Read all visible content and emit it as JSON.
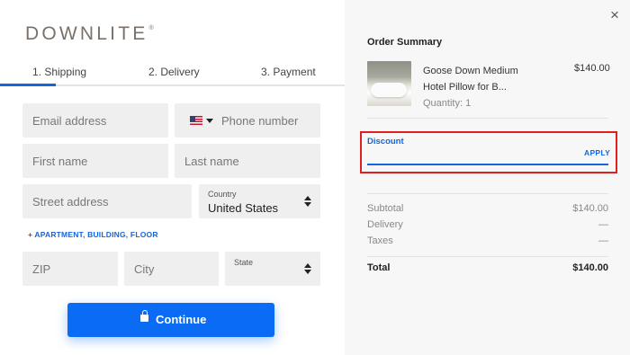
{
  "brand": {
    "logo_text": "DOWNLITE",
    "logo_mark": "®"
  },
  "steps": [
    {
      "label": "1. Shipping",
      "active": true
    },
    {
      "label": "2. Delivery",
      "active": false
    },
    {
      "label": "3. Payment",
      "active": false
    }
  ],
  "form": {
    "email_placeholder": "Email address",
    "phone_country_flag": "us-flag-icon",
    "phone_placeholder": "Phone number",
    "first_name_placeholder": "First name",
    "last_name_placeholder": "Last name",
    "street_placeholder": "Street address",
    "country_label": "Country",
    "country_value": "United States",
    "apartment_link": "+ APARTMENT, BUILDING, FLOOR",
    "zip_placeholder": "ZIP",
    "city_placeholder": "City",
    "state_label": "State"
  },
  "continue_button": {
    "label": "Continue",
    "icon": "lock-icon"
  },
  "close_icon": "×",
  "summary": {
    "title": "Order Summary",
    "item": {
      "name": "Goose Down Medium Hotel Pillow for B...",
      "quantity": "Quantity: 1",
      "price": "$140.00"
    },
    "discount": {
      "label": "Discount",
      "apply": "APPLY",
      "value": ""
    },
    "rows": [
      {
        "label": "Subtotal",
        "value": "$140.00"
      },
      {
        "label": "Delivery",
        "value": "—"
      },
      {
        "label": "Taxes",
        "value": "—"
      }
    ],
    "total": {
      "label": "Total",
      "value": "$140.00"
    }
  },
  "colors": {
    "accent": "#1565e0",
    "button": "#0a6cf5",
    "highlight": "#e02020",
    "brand_text": "#7a7068"
  }
}
